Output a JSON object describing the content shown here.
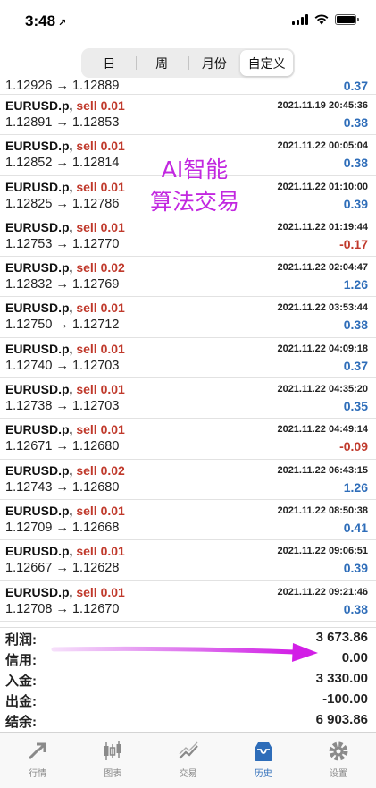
{
  "status_bar": {
    "time": "3:48",
    "location_arrow": "↗"
  },
  "period_tabs": [
    {
      "label": "日",
      "active": false
    },
    {
      "label": "周",
      "active": false
    },
    {
      "label": "月份",
      "active": false
    },
    {
      "label": "自定义",
      "active": true
    }
  ],
  "watermark": {
    "line1": "AI智能",
    "line2": "算法交易"
  },
  "trades": [
    {
      "symbol": "",
      "side": "",
      "time": "",
      "prices": "1.12926 → 1.12889",
      "profit": "0.37",
      "partial": true
    },
    {
      "symbol": "EURUSD.p,",
      "side": "sell 0.01",
      "time": "2021.11.19 20:45:36",
      "prices": "1.12891 → 1.12853",
      "profit": "0.38"
    },
    {
      "symbol": "EURUSD.p,",
      "side": "sell 0.01",
      "time": "2021.11.22 00:05:04",
      "prices": "1.12852 → 1.12814",
      "profit": "0.38"
    },
    {
      "symbol": "EURUSD.p,",
      "side": "sell 0.01",
      "time": "2021.11.22 01:10:00",
      "prices": "1.12825 → 1.12786",
      "profit": "0.39"
    },
    {
      "symbol": "EURUSD.p,",
      "side": "sell 0.01",
      "time": "2021.11.22 01:19:44",
      "prices": "1.12753 → 1.12770",
      "profit": "-0.17"
    },
    {
      "symbol": "EURUSD.p,",
      "side": "sell 0.02",
      "time": "2021.11.22 02:04:47",
      "prices": "1.12832 → 1.12769",
      "profit": "1.26"
    },
    {
      "symbol": "EURUSD.p,",
      "side": "sell 0.01",
      "time": "2021.11.22 03:53:44",
      "prices": "1.12750 → 1.12712",
      "profit": "0.38"
    },
    {
      "symbol": "EURUSD.p,",
      "side": "sell 0.01",
      "time": "2021.11.22 04:09:18",
      "prices": "1.12740 → 1.12703",
      "profit": "0.37"
    },
    {
      "symbol": "EURUSD.p,",
      "side": "sell 0.01",
      "time": "2021.11.22 04:35:20",
      "prices": "1.12738 → 1.12703",
      "profit": "0.35"
    },
    {
      "symbol": "EURUSD.p,",
      "side": "sell 0.01",
      "time": "2021.11.22 04:49:14",
      "prices": "1.12671 → 1.12680",
      "profit": "-0.09"
    },
    {
      "symbol": "EURUSD.p,",
      "side": "sell 0.02",
      "time": "2021.11.22 06:43:15",
      "prices": "1.12743 → 1.12680",
      "profit": "1.26"
    },
    {
      "symbol": "EURUSD.p,",
      "side": "sell 0.01",
      "time": "2021.11.22 08:50:38",
      "prices": "1.12709 → 1.12668",
      "profit": "0.41"
    },
    {
      "symbol": "EURUSD.p,",
      "side": "sell 0.01",
      "time": "2021.11.22 09:06:51",
      "prices": "1.12667 → 1.12628",
      "profit": "0.39"
    },
    {
      "symbol": "EURUSD.p,",
      "side": "sell 0.01",
      "time": "2021.11.22 09:21:46",
      "prices": "1.12708 → 1.12670",
      "profit": "0.38"
    }
  ],
  "summary": [
    {
      "label": "利润:",
      "value": "3 673.86"
    },
    {
      "label": "信用:",
      "value": "0.00"
    },
    {
      "label": "入金:",
      "value": "3 330.00"
    },
    {
      "label": "出金:",
      "value": "-100.00"
    },
    {
      "label": "结余:",
      "value": "6 903.86"
    }
  ],
  "tabbar": [
    {
      "label": "行情",
      "icon": "quotes-icon",
      "active": false
    },
    {
      "label": "图表",
      "icon": "chart-icon",
      "active": false
    },
    {
      "label": "交易",
      "icon": "trade-icon",
      "active": false
    },
    {
      "label": "历史",
      "icon": "history-icon",
      "active": true
    },
    {
      "label": "设置",
      "icon": "settings-icon",
      "active": false
    }
  ],
  "colors": {
    "profit_positive": "#2e6db9",
    "profit_negative": "#c0392b",
    "sell": "#c0392b",
    "annotation": "#c228e0",
    "active_tab": "#2e6db9"
  }
}
